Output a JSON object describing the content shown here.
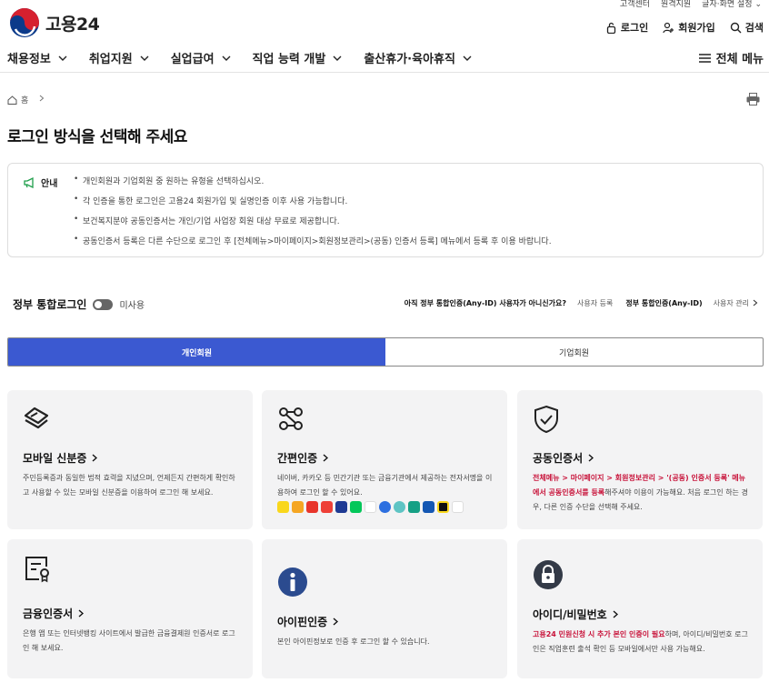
{
  "utility": [
    "고객센터",
    "원격지원",
    "글자·화면 설정"
  ],
  "brand": {
    "name": "고용24"
  },
  "auth": {
    "login": "로그인",
    "signup": "회원가입",
    "search": "검색"
  },
  "gnb": {
    "items": [
      "채용정보",
      "취업지원",
      "실업급여",
      "직업 능력 개발",
      "출산휴가·육아휴직"
    ],
    "all_menu": "전체 메뉴"
  },
  "breadcrumb": {
    "home": "홈"
  },
  "page_title": "로그인 방식을 선택해 주세요",
  "notice": {
    "label": "안내",
    "items": [
      "개인회원과 기업회원 중 원하는 유형을 선택하십시오.",
      "각 인증을 통한 로그인은 고용24 회원가입 및 실명인증 이후 사용 가능합니다.",
      "보건복지분야 공동인증서는 개인/기업 사업장 회원 대상 무료로 제공합니다.",
      "공동인증서 등록은 다른 수단으로 로그인 후 [전체메뉴>마이페이지>회원정보관리>(공동) 인증서 등록] 메뉴에서 등록 후 이용 바랍니다."
    ]
  },
  "gov_login": {
    "label": "정부 통합로그인",
    "state": "미사용"
  },
  "anyid": {
    "question": "아직 정부 통합인증(Any-ID) 사용자가 아니신가요?",
    "register": "사용자 등록",
    "label": "정부 통합인증(Any-ID)",
    "manage": "사용자 관리"
  },
  "tabs": {
    "personal": "개인회원",
    "business": "기업회원"
  },
  "cards": {
    "mobile": {
      "title": "모바일 신분증",
      "desc": "주민등록증과 동일한 법적 효력을 지녔으며, 언제든지 간편하게 확인하고 사용할 수 있는 모바일 신분증을 이용하여 로그인 해 보세요."
    },
    "simple": {
      "title": "간편인증",
      "desc": "네이버, 카카오 등 민간기관 또는 금융기관에서 제공하는 전자서명을 이용하여 로그인 할 수 있어요."
    },
    "joint": {
      "title": "공동인증서",
      "desc_red": "전체메뉴 > 마이페이지 > 회원정보관리 > '(공동) 인증서 등록' 메뉴에서 공동인증서를 등록",
      "desc": "해주셔야 이용이 가능해요. 처음 로그인 하는 경우, 다른 인증 수단을 선택해 주세요."
    },
    "finance": {
      "title": "금융인증서",
      "desc": "은행 앱 또는 인터넷뱅킹 사이트에서 발급한 금융결제원 인증서로 로그인 해 보세요."
    },
    "ipin": {
      "title": "아이핀인증",
      "desc": "본인 아이핀정보로 인증 후 로그인 할 수 있습니다."
    },
    "idpw": {
      "title": "아이디/비밀번호",
      "desc_red": "고용24 민원신청 시 추가 본인 인증이 필요",
      "desc": "하며, 아이디/비밀번호 로그인은 직업훈련 출석 확인 등 모바일에서만 사용 가능해요."
    }
  },
  "colors": {
    "accent": "#3b59d1",
    "red": "#c8133a",
    "card_bg": "#f3f3f4"
  },
  "simple_auth_badges": [
    "#f9d71c",
    "#f5a623",
    "#e8352b",
    "#ee4037",
    "#1f3a93",
    "#03c75a",
    "#ffffff",
    "#2d6fe0",
    "#5ec4c4",
    "#16a085",
    "#1457b3",
    "#111111",
    "#ffffff"
  ]
}
